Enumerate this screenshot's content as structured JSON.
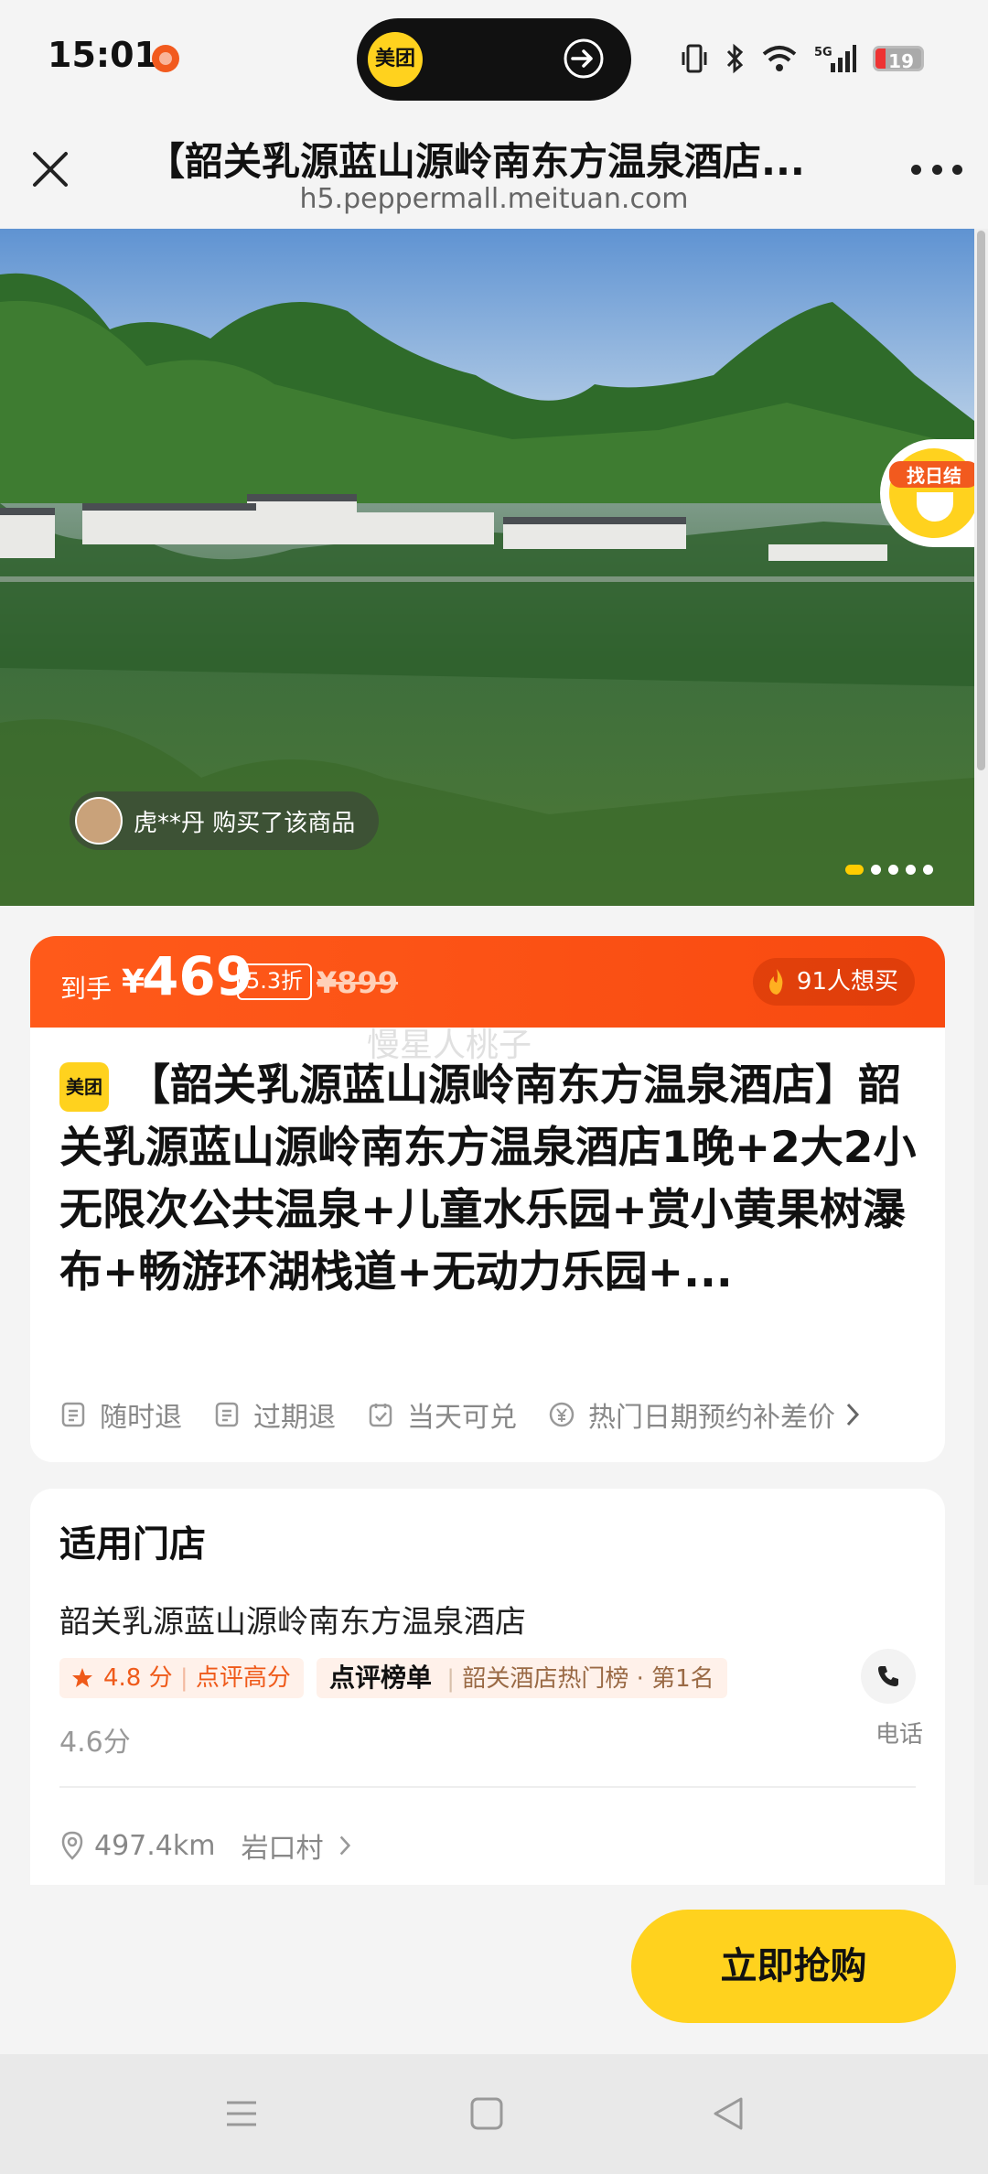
{
  "status_bar": {
    "time": "15:01",
    "island_logo": "美团",
    "battery": "19",
    "icons": [
      "vibrate-icon",
      "bluetooth-icon",
      "wifi-icon",
      "5g-signal-icon",
      "battery-icon"
    ]
  },
  "nav": {
    "title": "【韶关乳源蓝山源岭南东方温泉酒店...",
    "url": "h5.peppermall.meituan.com"
  },
  "hero": {
    "buyer_text": "虎**丹 购买了该商品",
    "float_badge": "找日结",
    "slides": 5,
    "active_slide": 1
  },
  "price": {
    "prefix": "到手",
    "currency": "¥",
    "value": "469",
    "discount": "5.3折",
    "original": "¥899",
    "want": "91人想买"
  },
  "product": {
    "watermark": "慢星人桃子",
    "brand_logo": "美团",
    "title": "【韶关乳源蓝山源岭南东方温泉酒店】韶关乳源蓝山源岭南东方温泉酒店1晚+2大2小无限次公共温泉+儿童水乐园+赏小黄果树瀑布+畅游环湖栈道+无动力乐园+...",
    "tags": [
      "随时退",
      "过期退",
      "当天可兑",
      "热门日期预约补差价"
    ]
  },
  "store": {
    "section_title": "适用门店",
    "name": "韶关乳源蓝山源岭南东方温泉酒店",
    "rating": "4.8 分",
    "rating_label": "点评高分",
    "rank_brand": "点评榜单",
    "rank_text": "韶关酒店热门榜 · 第1名",
    "score_sub": "4.6分",
    "phone_label": "电话",
    "distance": "497.4km",
    "address": "岩口村"
  },
  "bottom": {
    "buy_label": "立即抢购"
  },
  "colors": {
    "accent_yellow": "#ffd21e",
    "price_orange": "#ff5a1a"
  }
}
